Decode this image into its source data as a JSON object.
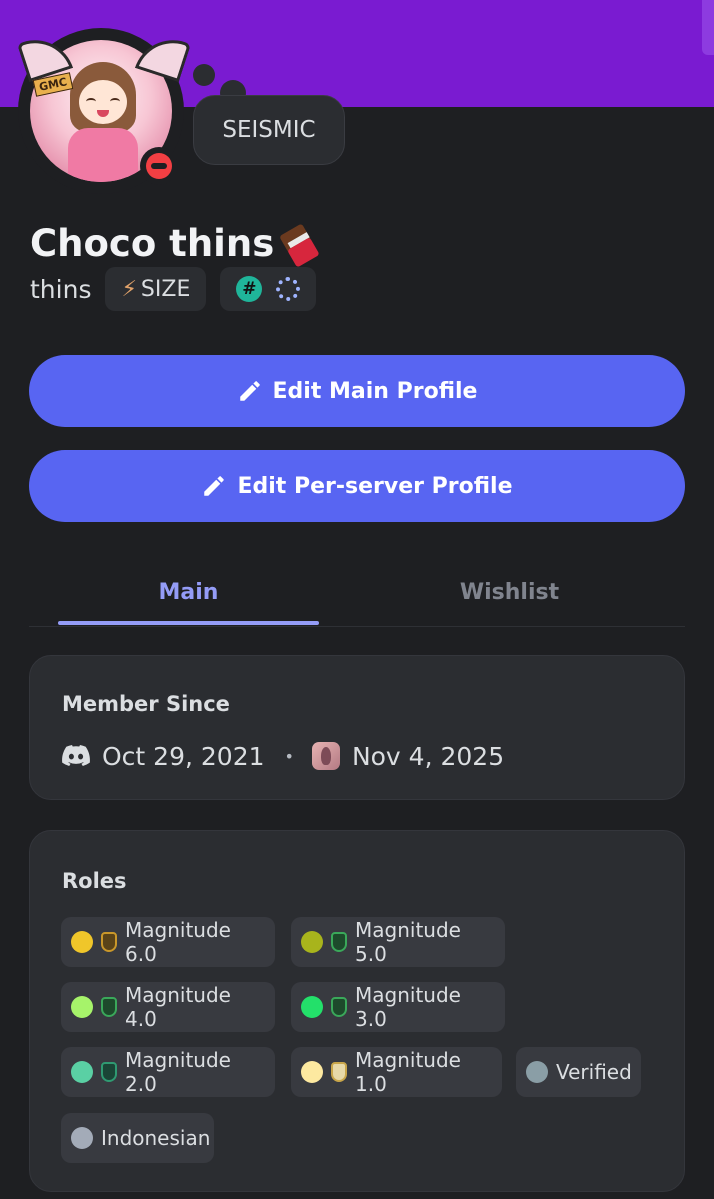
{
  "profile": {
    "status_bubble": "SEISMIC",
    "display_name": "Choco thins",
    "username": "thins",
    "tag_chip": "SIZE",
    "avatar_tag": "GMC"
  },
  "buttons": {
    "edit_main": "Edit Main Profile",
    "edit_server": "Edit Per-server Profile"
  },
  "tabs": {
    "main": "Main",
    "wishlist": "Wishlist"
  },
  "member_since": {
    "title": "Member Since",
    "discord_date": "Oct 29, 2021",
    "separator": "•",
    "server_date": "Nov 4, 2025"
  },
  "roles": {
    "title": "Roles",
    "items": [
      {
        "label": "Magnitude 6.0",
        "color": "#f0c62a",
        "icon_color": "#c9972a"
      },
      {
        "label": "Magnitude 5.0",
        "color": "#a8b41c",
        "icon_color": "#3aa85a"
      },
      {
        "label": "Magnitude 4.0",
        "color": "#a6f36a",
        "icon_color": "#3aa85a"
      },
      {
        "label": "Magnitude 3.0",
        "color": "#23e06a",
        "icon_color": "#3aa85a"
      },
      {
        "label": "Magnitude 2.0",
        "color": "#5ad0a4",
        "icon_color": "#2f9a72"
      },
      {
        "label": "Magnitude 1.0",
        "color": "#fde9a0",
        "icon_color": "#c9a64a"
      },
      {
        "label": "Verified",
        "color": "#8a9ea6"
      },
      {
        "label": "Indonesian",
        "color": "#a3abb8"
      }
    ]
  },
  "colors": {
    "banner": "#7a1bd1",
    "accent": "#5865f2",
    "tab_active": "#949cf7",
    "dnd": "#f23f43"
  }
}
